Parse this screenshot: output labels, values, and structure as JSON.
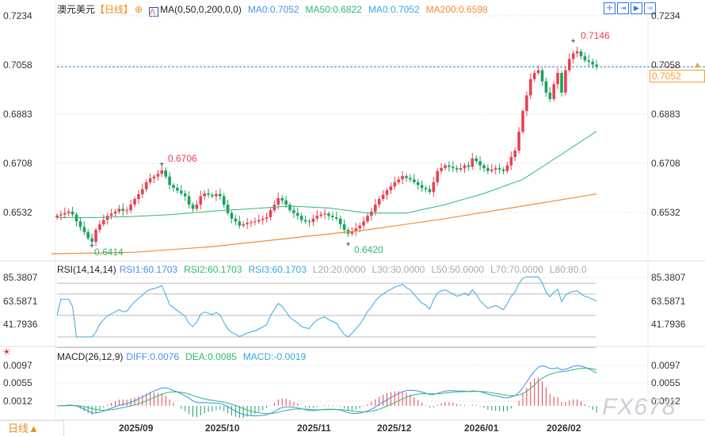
{
  "header": {
    "symbol": "澳元美元",
    "period_tag": "【日线】",
    "ma_label": "MA(0,50,0,200,0,0)",
    "ma0": "MA0:0.7052",
    "ma50": "MA50:0.6822",
    "ma0b": "MA0:0.7052",
    "ma200": "MA200:0.6598",
    "toolbar_icons": [
      "crosshair-icon",
      "zoom-in-icon",
      "play-icon",
      "exit-icon"
    ]
  },
  "rsi_legend": {
    "title": "RSI(14,14,14)",
    "rsi1": "RSI1:60.1703",
    "rsi2": "RSI2:60.1703",
    "rsi3": "RSI3:60.1703",
    "l20": "L20:20.0000",
    "l30": "L30:30.0000",
    "l50": "L50:50.0000",
    "l70": "L70:70.0000",
    "l80": "L80:80.0"
  },
  "macd_legend": {
    "title": "MACD(26,12,9)",
    "diff": "DIFF:0.0076",
    "dea": "DEA:0.0085",
    "macd": "MACD:-0.0019"
  },
  "price_axis": [
    "0.7234",
    "0.7058",
    "0.6883",
    "0.6708",
    "0.6532"
  ],
  "rsi_axis": [
    "85.3807",
    "63.5871",
    "41.7936"
  ],
  "macd_axis": [
    "0.0097",
    "0.0055",
    "0.0012"
  ],
  "current_price": "0.7052",
  "annotations": {
    "high1": "0.6706",
    "low1": "0.6414",
    "low2": "0.6420",
    "high2": "0.7146"
  },
  "x_axis": [
    "2025/09",
    "2025/10",
    "2025/11",
    "2025/12",
    "2026/01",
    "2026/02"
  ],
  "period_button": "日线▲",
  "watermark": "FX678",
  "colors": {
    "up": "#e8424f",
    "down": "#1aa260",
    "ma50": "#2eb872",
    "ma200": "#f08c3a",
    "rsi": "#3aa6e0",
    "diff": "#3a8ee8",
    "dea": "#2eb872",
    "accent": "#f08c1e"
  },
  "chart_data": {
    "type": "candlestick",
    "price_range": [
      0.6371,
      0.7234
    ],
    "close": [
      0.6521,
      0.6525,
      0.653,
      0.6535,
      0.6525,
      0.65,
      0.648,
      0.6462,
      0.644,
      0.6427,
      0.647,
      0.649,
      0.6505,
      0.652,
      0.6528,
      0.6535,
      0.6545,
      0.6538,
      0.654,
      0.656,
      0.658,
      0.6597,
      0.6615,
      0.664,
      0.6654,
      0.666,
      0.667,
      0.6682,
      0.666,
      0.663,
      0.662,
      0.661,
      0.66,
      0.659,
      0.656,
      0.6545,
      0.656,
      0.659,
      0.66,
      0.6595,
      0.659,
      0.6598,
      0.659,
      0.656,
      0.653,
      0.651,
      0.65,
      0.6485,
      0.649,
      0.6495,
      0.6498,
      0.65,
      0.6505,
      0.651,
      0.6515,
      0.654,
      0.656,
      0.6583,
      0.6575,
      0.656,
      0.654,
      0.653,
      0.652,
      0.6505,
      0.65,
      0.6498,
      0.651,
      0.652,
      0.6525,
      0.6528,
      0.652,
      0.6515,
      0.651,
      0.649,
      0.647,
      0.6456,
      0.6465,
      0.6475,
      0.6485,
      0.65,
      0.652,
      0.6535,
      0.656,
      0.658,
      0.6595,
      0.6611,
      0.6625,
      0.664,
      0.665,
      0.6662,
      0.6655,
      0.665,
      0.664,
      0.663,
      0.662,
      0.6615,
      0.6605,
      0.664,
      0.668,
      0.6691,
      0.67,
      0.6695,
      0.669,
      0.6685,
      0.669,
      0.67,
      0.6695,
      0.6725,
      0.6715,
      0.67,
      0.669,
      0.668,
      0.6685,
      0.669,
      0.6685,
      0.668,
      0.67,
      0.673,
      0.6753,
      0.682,
      0.6894,
      0.695,
      0.7008,
      0.703,
      0.704,
      0.7,
      0.696,
      0.6937,
      0.699,
      0.703,
      0.696,
      0.704,
      0.708,
      0.71,
      0.7107,
      0.709,
      0.7075,
      0.707,
      0.706,
      0.7052
    ],
    "ma50_every10": [
      0.6514,
      0.6514,
      0.6518,
      0.6525,
      0.6537,
      0.6545,
      0.6555,
      0.6548,
      0.653,
      0.653,
      0.656,
      0.66,
      0.665,
      0.674,
      0.6822
    ],
    "ma200_every20": [
      0.6385,
      0.639,
      0.641,
      0.644,
      0.647,
      0.651,
      0.6555,
      0.6598
    ],
    "rsi_range": [
      41.7936,
      85.3807
    ],
    "rsi_levels": [
      20,
      30,
      50,
      70,
      80
    ],
    "macd_range": [
      0.0012,
      0.0097
    ]
  }
}
